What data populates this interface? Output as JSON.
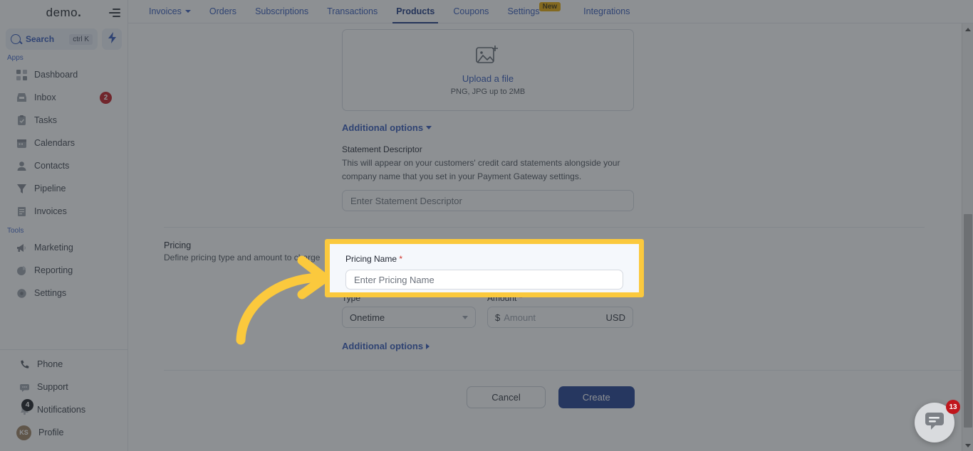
{
  "sidebar": {
    "brand": "demo",
    "brand_dot": ".",
    "search": {
      "label": "Search",
      "shortcut": "ctrl K"
    },
    "sections": [
      {
        "title": "Apps"
      },
      {
        "title": "Tools"
      }
    ],
    "apps_label": "Apps",
    "tools_label": "Tools",
    "apps": [
      {
        "label": "Dashboard",
        "icon": "grid-icon",
        "badge": ""
      },
      {
        "label": "Inbox",
        "icon": "inbox-icon",
        "badge": "2"
      },
      {
        "label": "Tasks",
        "icon": "clipboard-check-icon",
        "badge": ""
      },
      {
        "label": "Calendars",
        "icon": "calendar-icon",
        "badge": ""
      },
      {
        "label": "Contacts",
        "icon": "person-icon",
        "badge": ""
      },
      {
        "label": "Pipeline",
        "icon": "funnel-icon",
        "badge": ""
      },
      {
        "label": "Invoices",
        "icon": "invoice-icon",
        "badge": ""
      }
    ],
    "tools": [
      {
        "label": "Marketing",
        "icon": "megaphone-icon",
        "badge": ""
      },
      {
        "label": "Reporting",
        "icon": "pie-chart-icon",
        "badge": ""
      },
      {
        "label": "Settings",
        "icon": "gear-icon",
        "badge": ""
      }
    ],
    "bottom": [
      {
        "label": "Phone",
        "icon": "phone-icon",
        "badge": ""
      },
      {
        "label": "Support",
        "icon": "chat-icon",
        "badge": ""
      },
      {
        "label": "Notifications",
        "icon": "bell-icon",
        "badge": "4"
      },
      {
        "label": "Profile",
        "icon": "avatar-icon",
        "badge": "",
        "initials": "KS"
      }
    ]
  },
  "topnav": {
    "items": [
      {
        "label": "Invoices",
        "has_caret": true,
        "active": false,
        "badge": ""
      },
      {
        "label": "Orders",
        "has_caret": false,
        "active": false,
        "badge": ""
      },
      {
        "label": "Subscriptions",
        "has_caret": false,
        "active": false,
        "badge": ""
      },
      {
        "label": "Transactions",
        "has_caret": false,
        "active": false,
        "badge": ""
      },
      {
        "label": "Products",
        "has_caret": false,
        "active": true,
        "badge": ""
      },
      {
        "label": "Coupons",
        "has_caret": false,
        "active": false,
        "badge": ""
      },
      {
        "label": "Settings",
        "has_caret": false,
        "active": false,
        "badge": "New"
      },
      {
        "label": "Integrations",
        "has_caret": false,
        "active": false,
        "badge": ""
      }
    ]
  },
  "form": {
    "upload": {
      "link": "Upload a file",
      "hint": "PNG, JPG up to 2MB",
      "icon": "image-plus-icon"
    },
    "additional_options_top": "Additional options",
    "statement": {
      "label": "Statement Descriptor",
      "description": "This will appear on your customers' credit card statements alongside your company name that you set in your Payment Gateway settings.",
      "placeholder": "Enter Statement Descriptor",
      "value": ""
    },
    "pricing": {
      "section_title": "Pricing",
      "section_subtitle": "Define pricing type and amount to charge",
      "name_label": "Pricing Name",
      "name_required": "*",
      "name_placeholder": "Enter Pricing Name",
      "name_value": "",
      "type_label": "Type",
      "type_value": "Onetime",
      "amount_label": "Amount",
      "amount_required": "*",
      "amount_currency_symbol": "$",
      "amount_placeholder": "Amount",
      "amount_currency": "USD"
    },
    "additional_options_bottom": "Additional options",
    "buttons": {
      "cancel": "Cancel",
      "create": "Create"
    }
  },
  "chat": {
    "badge": "13",
    "icon": "chat-bubble-icon"
  },
  "annotation": {
    "highlight_color": "#fbc93d",
    "arrow_color": "#fbc93d",
    "target": "pricing-name-field"
  },
  "colors": {
    "accent_blue": "#2f55b8",
    "primary_button": "#1b3a8f",
    "badge_red": "#c0161c",
    "badge_new": "#e8a800"
  }
}
